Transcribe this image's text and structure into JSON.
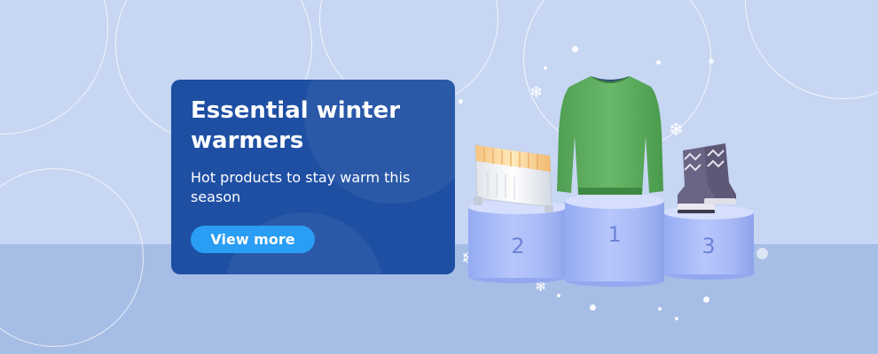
{
  "promo": {
    "title": "Essential winter warmers",
    "subtitle": "Hot products to stay warm this season",
    "cta_label": "View more"
  },
  "podium": {
    "first_label": "1",
    "second_label": "2",
    "third_label": "3"
  },
  "products": [
    "heater-image",
    "sweater-image",
    "boots-image"
  ],
  "colors": {
    "background": "#c7d6f3",
    "floor": "#a6bde6",
    "card": "#1e4fa3",
    "button": "#2a9df4",
    "podium": "#b0c1f8",
    "rank_text": "#6d84d6"
  }
}
